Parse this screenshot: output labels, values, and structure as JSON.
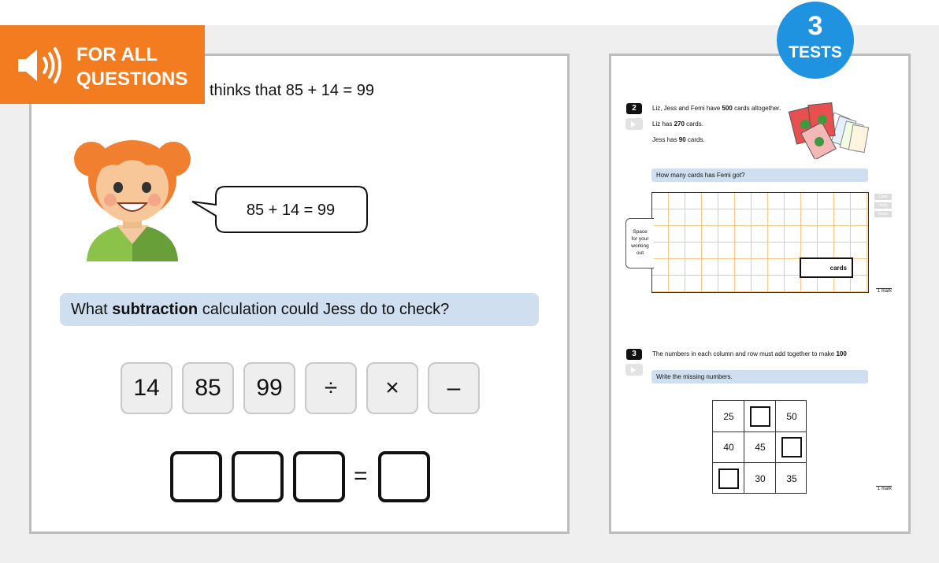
{
  "audio_banner": {
    "line1": "FOR ALL",
    "line2": "QUESTIONS",
    "icon": "speaker-icon"
  },
  "tests_badge": {
    "number": "3",
    "label": "TESTS"
  },
  "question": {
    "text": "thinks that 85 + 14 = 99",
    "speech": "85 + 14 = 99",
    "prompt_before": "What ",
    "prompt_bold": "subtraction",
    "prompt_after": " calculation could Jess do to check?"
  },
  "tiles": [
    "14",
    "85",
    "99",
    "÷",
    "×",
    "–"
  ],
  "answer_row": {
    "equals": "="
  },
  "preview": {
    "q2": {
      "number": "2",
      "line1_before": "Liz, Jess and Femi have ",
      "line1_bold": "500",
      "line1_after": " cards altogether.",
      "line2_before": "Liz has ",
      "line2_bold": "270",
      "line2_after": " cards.",
      "line3_before": "Jess has ",
      "line3_bold": "90",
      "line3_after": " cards.",
      "prompt": "How many cards has Femi got?",
      "tools": [
        "Clear",
        "Undo",
        "Redo"
      ],
      "working_out": [
        "Space",
        "for your",
        "working",
        "out"
      ],
      "answer_unit": "cards",
      "mark": "1 mark"
    },
    "q3": {
      "number": "3",
      "line1_before": "The numbers in each column and row must add together to make ",
      "line1_bold": "100",
      "prompt": "Write the missing numbers.",
      "grid": [
        [
          "25",
          "",
          "50"
        ],
        [
          "40",
          "45",
          ""
        ],
        [
          "",
          "30",
          "35"
        ]
      ],
      "mark": "1 mark"
    }
  },
  "colors": {
    "accent_orange": "#f47c20",
    "badge_blue": "#1f93e0",
    "prompt_bg": "#cfdff0"
  }
}
